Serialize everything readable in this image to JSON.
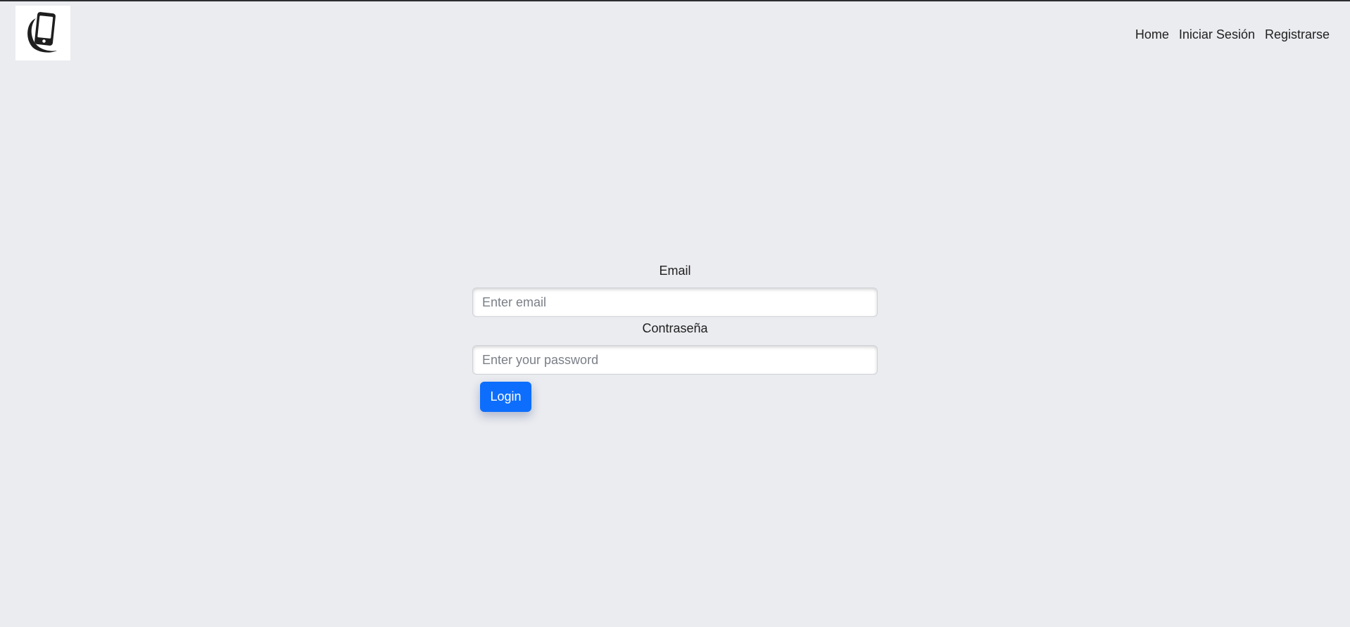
{
  "header": {
    "logo_icon": "smartphone-icon",
    "nav": [
      {
        "label": "Home"
      },
      {
        "label": "Iniciar Sesión"
      },
      {
        "label": "Registrarse"
      }
    ]
  },
  "login_form": {
    "email_label": "Email",
    "email_placeholder": "Enter email",
    "email_value": "",
    "password_label": "Contraseña",
    "password_placeholder": "Enter your password",
    "password_value": "",
    "submit_label": "Login"
  },
  "colors": {
    "background": "#ebecf0",
    "primary_button": "#0d6efd",
    "text": "#1f1f1f"
  }
}
